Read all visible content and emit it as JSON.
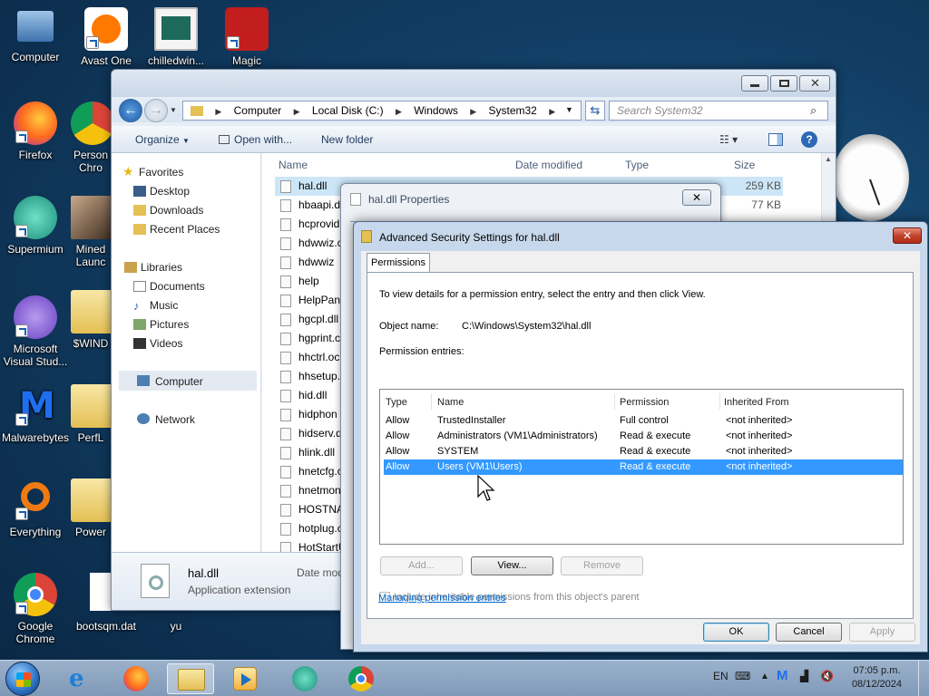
{
  "desktop": {
    "icons": [
      {
        "label": "Computer"
      },
      {
        "label": "Avast One"
      },
      {
        "label": "chilledwin..."
      },
      {
        "label": "Magic"
      },
      {
        "label": "Firefox"
      },
      {
        "label": "Person Chro"
      },
      {
        "label": "Supermium"
      },
      {
        "label": "Mined Launc"
      },
      {
        "label": "Microsoft Visual Stud..."
      },
      {
        "label": "$WIND"
      },
      {
        "label": "Malwarebytes"
      },
      {
        "label": "PerfL"
      },
      {
        "label": "Everything"
      },
      {
        "label": "Power"
      },
      {
        "label": "Google Chrome"
      },
      {
        "label": "bootsqm.dat"
      },
      {
        "label": "yu"
      }
    ]
  },
  "explorer": {
    "address": [
      "Computer",
      "Local Disk (C:)",
      "Windows",
      "System32"
    ],
    "search_placeholder": "Search System32",
    "toolbar": {
      "organize": "Organize",
      "open_with": "Open with...",
      "new_folder": "New folder"
    },
    "nav": {
      "favorites": "Favorites",
      "desktop": "Desktop",
      "downloads": "Downloads",
      "recent": "Recent Places",
      "libraries": "Libraries",
      "documents": "Documents",
      "music": "Music",
      "pictures": "Pictures",
      "videos": "Videos",
      "computer": "Computer",
      "network": "Network"
    },
    "columns": {
      "name": "Name",
      "date": "Date modified",
      "type": "Type",
      "size": "Size"
    },
    "files": [
      {
        "name": "hal.dll",
        "size": "259 KB"
      },
      {
        "name": "hbaapi.d",
        "size": "77 KB"
      },
      {
        "name": "hcprovid",
        "size": ""
      },
      {
        "name": "hdwwiz.c",
        "size": ""
      },
      {
        "name": "hdwwiz",
        "size": ""
      },
      {
        "name": "help",
        "size": ""
      },
      {
        "name": "HelpPane",
        "size": ""
      },
      {
        "name": "hgcpl.dll",
        "size": ""
      },
      {
        "name": "hgprint.c",
        "size": ""
      },
      {
        "name": "hhctrl.oc",
        "size": ""
      },
      {
        "name": "hhsetup.",
        "size": ""
      },
      {
        "name": "hid.dll",
        "size": ""
      },
      {
        "name": "hidphon",
        "size": ""
      },
      {
        "name": "hidserv.d",
        "size": ""
      },
      {
        "name": "hlink.dll",
        "size": ""
      },
      {
        "name": "hnetcfg.c",
        "size": ""
      },
      {
        "name": "hnetmon",
        "size": ""
      },
      {
        "name": "HOSTNA",
        "size": ""
      },
      {
        "name": "hotplug.c",
        "size": ""
      },
      {
        "name": "HotStartU",
        "size": ""
      }
    ],
    "details": {
      "name": "hal.dll",
      "type": "Application extension",
      "date_label": "Date mod"
    }
  },
  "properties_dialog": {
    "title": "hal.dll Properties"
  },
  "advanced": {
    "title": "Advanced Security Settings for hal.dll",
    "tab": "Permissions",
    "instruction": "To view details for a permission entry, select the entry and then click View.",
    "object_label": "Object name:",
    "object_value": "C:\\Windows\\System32\\hal.dll",
    "entries_label": "Permission entries:",
    "headers": {
      "type": "Type",
      "name": "Name",
      "permission": "Permission",
      "inherited": "Inherited From"
    },
    "entries": [
      {
        "type": "Allow",
        "name": "TrustedInstaller",
        "permission": "Full control",
        "inherited": "<not inherited>"
      },
      {
        "type": "Allow",
        "name": "Administrators (VM1\\Administrators)",
        "permission": "Read & execute",
        "inherited": "<not inherited>"
      },
      {
        "type": "Allow",
        "name": "SYSTEM",
        "permission": "Read & execute",
        "inherited": "<not inherited>"
      },
      {
        "type": "Allow",
        "name": "Users (VM1\\Users)",
        "permission": "Read & execute",
        "inherited": "<not inherited>"
      }
    ],
    "selected_index": 3,
    "buttons": {
      "add": "Add...",
      "view": "View...",
      "remove": "Remove",
      "ok": "OK",
      "cancel": "Cancel",
      "apply": "Apply"
    },
    "include_label": "Include inheritable permissions from this object's parent",
    "manage_link": "Managing permission entries"
  },
  "taskbar": {
    "lang": "EN",
    "time": "07:05 p.m.",
    "date": "08/12/2024"
  }
}
